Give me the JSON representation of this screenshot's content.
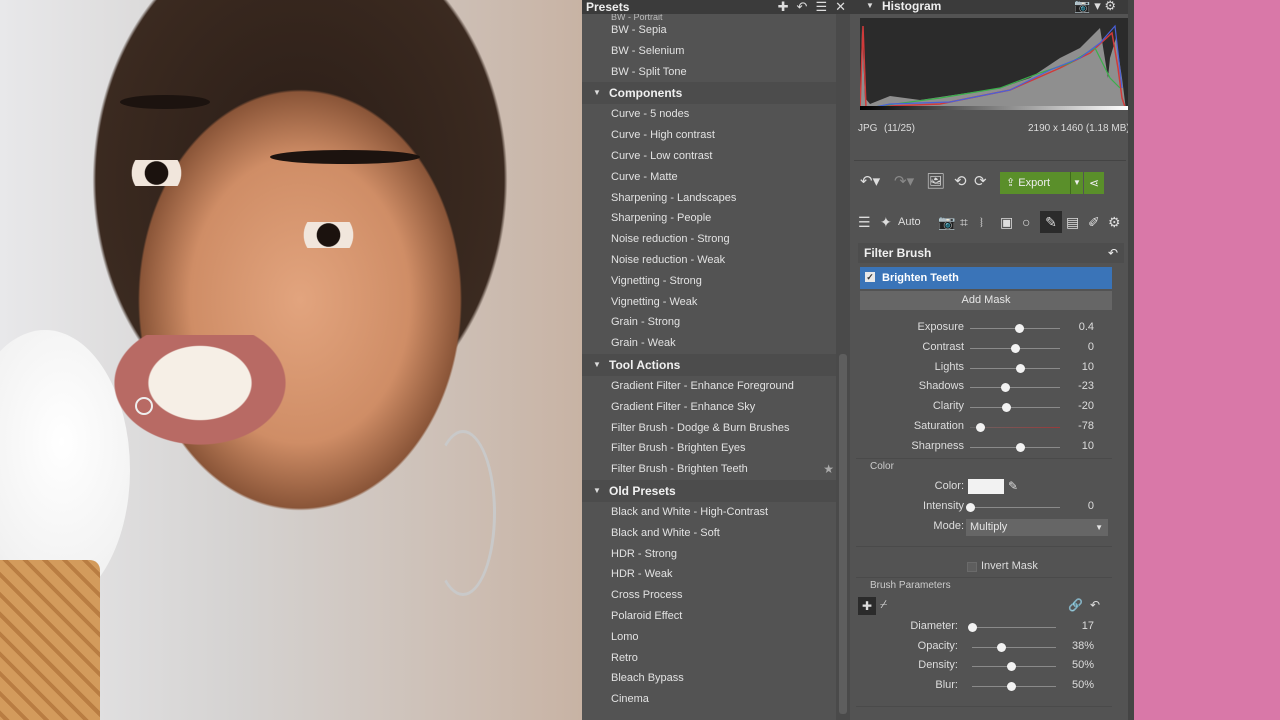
{
  "presets": {
    "title": "Presets",
    "toolbar_icons": [
      "add-icon",
      "revert-icon",
      "menu-icon",
      "close-icon"
    ],
    "top_cut_item": "BW - Portrait",
    "groups": [
      {
        "kind": "items",
        "items": [
          "BW - Sepia",
          "BW - Selenium",
          "BW - Split Tone"
        ]
      },
      {
        "kind": "category",
        "label": "Components"
      },
      {
        "kind": "items",
        "items": [
          "Curve - 5 nodes",
          "Curve - High contrast",
          "Curve - Low contrast",
          "Curve - Matte",
          "Sharpening - Landscapes",
          "Sharpening - People",
          "Noise reduction - Strong",
          "Noise reduction - Weak",
          "Vignetting - Strong",
          "Vignetting - Weak",
          "Grain - Strong",
          "Grain - Weak"
        ]
      },
      {
        "kind": "category",
        "label": "Tool Actions"
      },
      {
        "kind": "items",
        "items": [
          "Gradient Filter - Enhance Foreground",
          "Gradient Filter - Enhance Sky",
          "Filter Brush - Dodge & Burn Brushes",
          "Filter Brush - Brighten Eyes",
          "Filter Brush - Brighten Teeth"
        ],
        "starred": "Filter Brush - Brighten Teeth"
      },
      {
        "kind": "category",
        "label": "Old Presets"
      },
      {
        "kind": "items",
        "items": [
          "Black and White - High-Contrast",
          "Black and White - Soft",
          "HDR - Strong",
          "HDR - Weak",
          "Cross Process",
          "Polaroid Effect",
          "Lomo",
          "Retro",
          "Bleach Bypass",
          "Cinema"
        ]
      }
    ]
  },
  "histogram": {
    "title": "Histogram",
    "format": "JPG",
    "index": "(11/25)",
    "dimensions": "2190 x 1460 (1.18 MB)"
  },
  "toolbar": {
    "export_label": "Export",
    "auto_label": "Auto"
  },
  "filter_brush": {
    "title": "Filter Brush",
    "mask_name": "Brighten Teeth",
    "add_mask_label": "Add Mask",
    "sliders": [
      {
        "label": "Exposure",
        "value": "0.4",
        "pos": 0.54
      },
      {
        "label": "Contrast",
        "value": "0",
        "pos": 0.5
      },
      {
        "label": "Lights",
        "value": "10",
        "pos": 0.55
      },
      {
        "label": "Shadows",
        "value": "-23",
        "pos": 0.385
      },
      {
        "label": "Clarity",
        "value": "-20",
        "pos": 0.4
      },
      {
        "label": "Saturation",
        "value": "-78",
        "pos": 0.11
      },
      {
        "label": "Sharpness",
        "value": "10",
        "pos": 0.55
      }
    ],
    "color_section": "Color",
    "color_label": "Color:",
    "color_value": "#f2f2f2",
    "intensity_label": "Intensity",
    "intensity_value": "0",
    "intensity_pos": 0.0,
    "mode_label": "Mode:",
    "mode_value": "Multiply",
    "invert_label": "Invert Mask",
    "brush_section": "Brush Parameters",
    "brush": [
      {
        "label": "Diameter:",
        "value": "17",
        "pos": 0.0
      },
      {
        "label": "Opacity:",
        "value": "38%",
        "pos": 0.35
      },
      {
        "label": "Density:",
        "value": "50%",
        "pos": 0.47
      },
      {
        "label": "Blur:",
        "value": "50%",
        "pos": 0.47
      }
    ]
  }
}
